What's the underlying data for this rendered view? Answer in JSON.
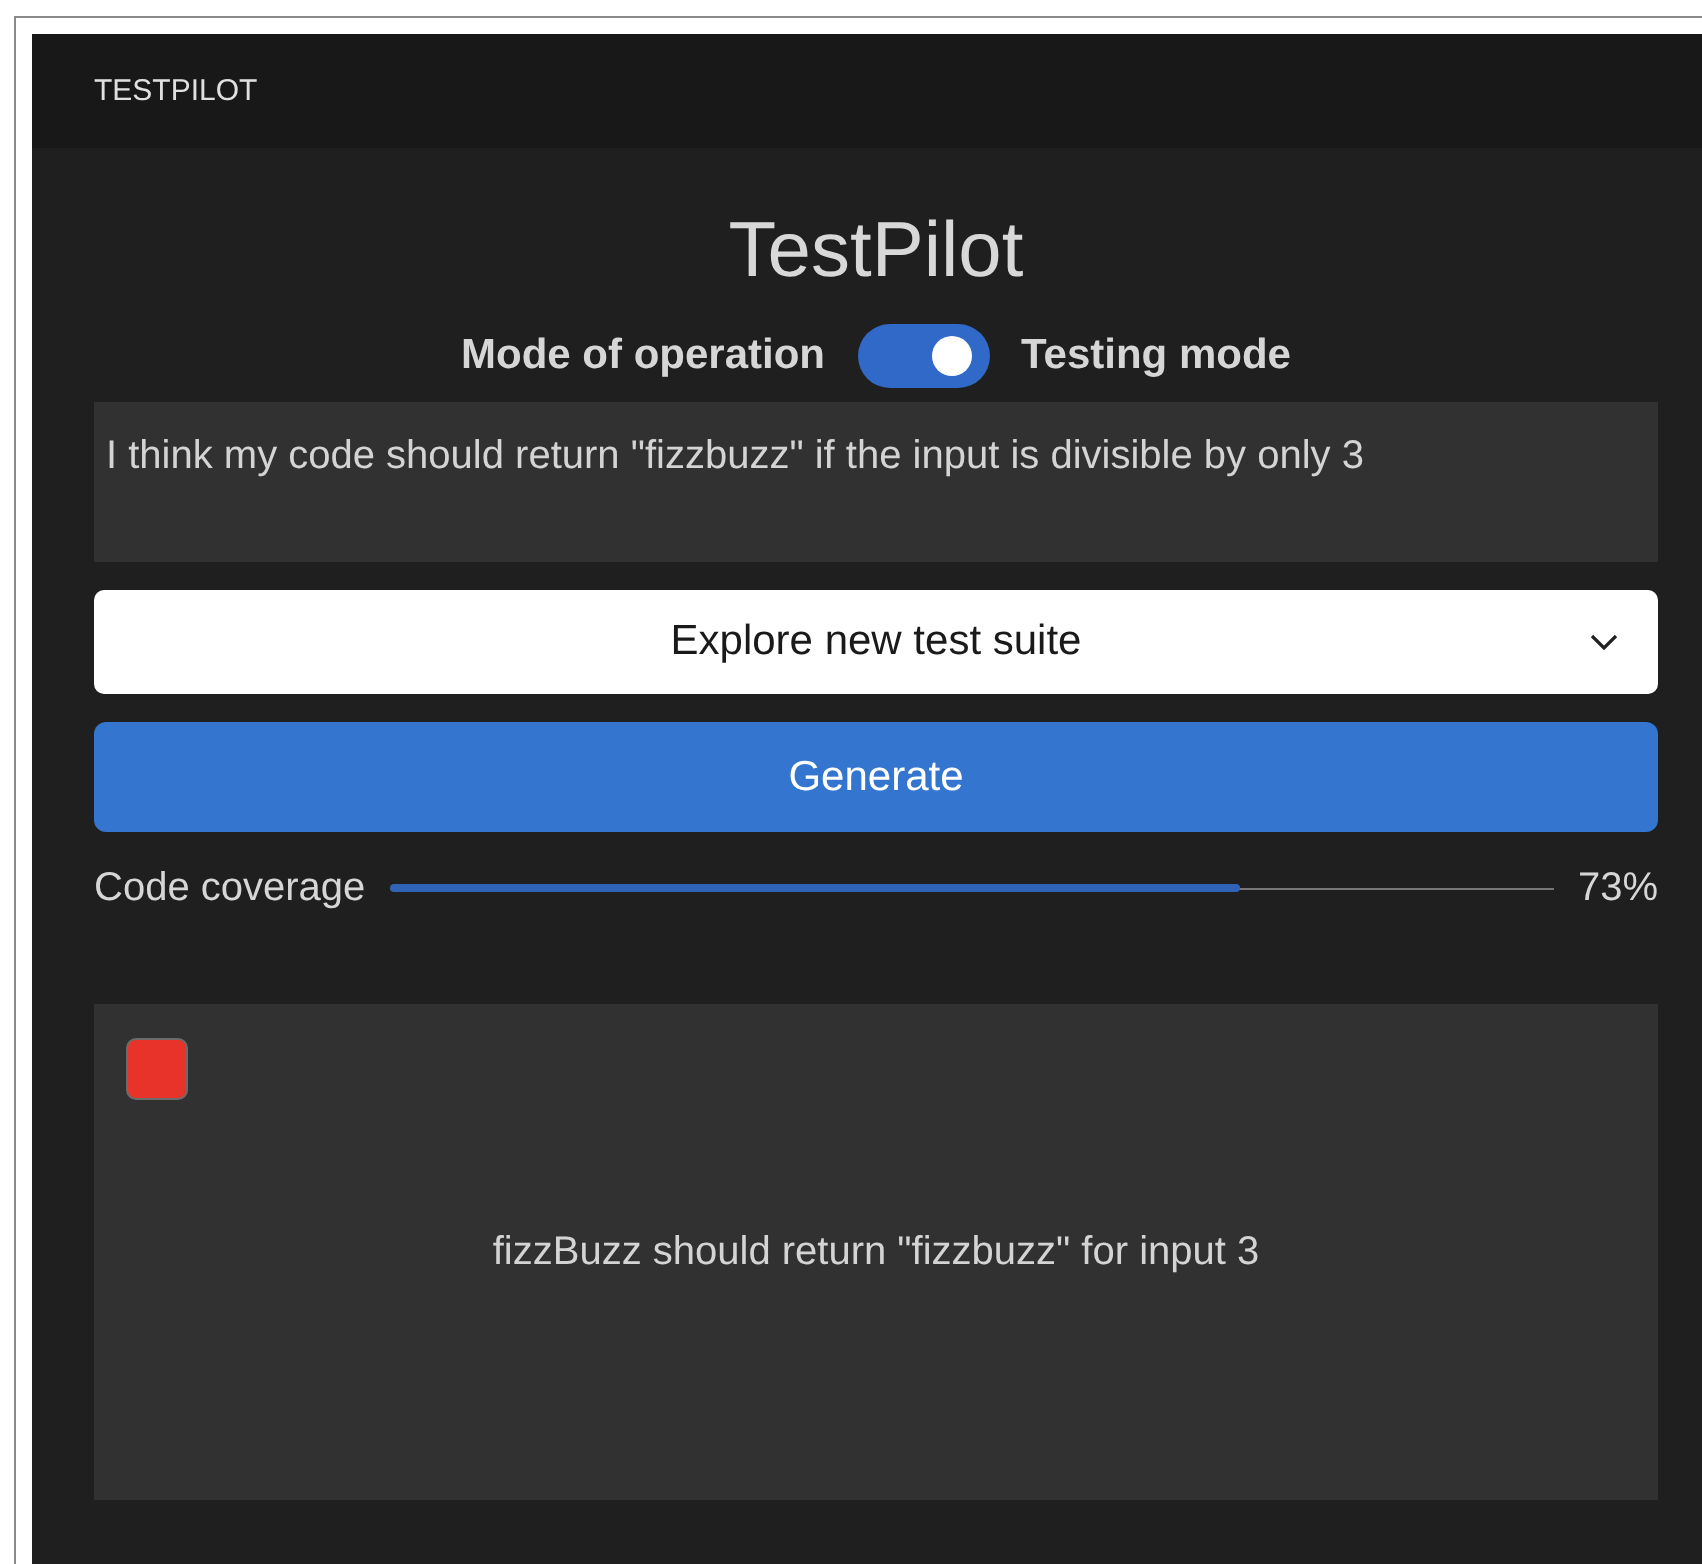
{
  "header": {
    "title": "TESTPILOT"
  },
  "app": {
    "title": "TestPilot"
  },
  "mode": {
    "label": "Mode of operation",
    "on": true,
    "value": "Testing mode"
  },
  "prompt": {
    "value": "I think my code should return \"fizzbuzz\" if the input is divisible by only 3"
  },
  "suite_select": {
    "value": "Explore new test suite"
  },
  "generate_button": {
    "label": "Generate"
  },
  "coverage": {
    "label": "Code coverage",
    "level": 0.73,
    "reading": "73%"
  },
  "results": [
    {
      "passed": false,
      "text": "fizzBuzz should return \"fizzbuzz\" for input 3"
    }
  ]
}
